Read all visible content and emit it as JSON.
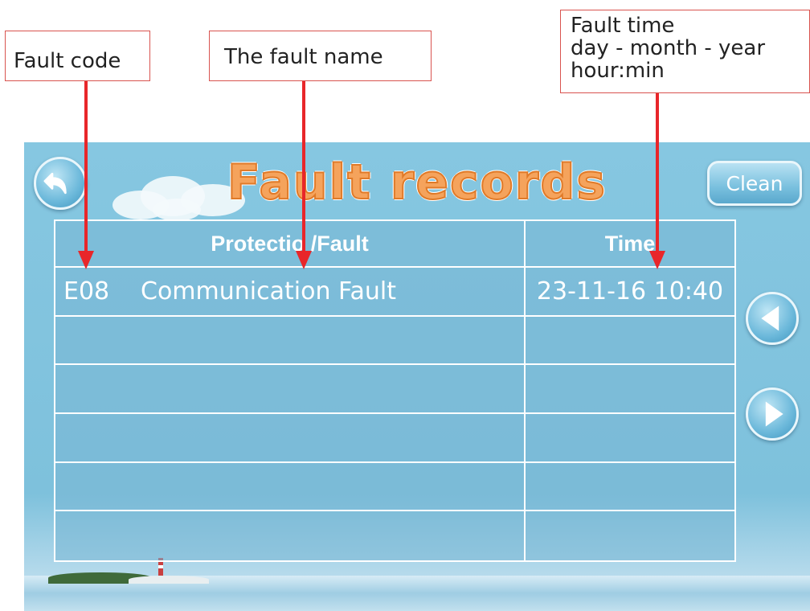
{
  "callouts": {
    "fault_code": "Fault code",
    "fault_name": "The fault name",
    "fault_time": [
      "Fault time",
      "day - month - year",
      "hour:min"
    ]
  },
  "screen": {
    "title": "Fault records",
    "clean_label": "Clean",
    "table": {
      "headers": [
        "Protectio /Fault",
        "Time"
      ],
      "rows": [
        {
          "code": "E08",
          "name": "Communication Fault",
          "time": "23-11-16 10:40"
        },
        {
          "code": "",
          "name": "",
          "time": ""
        },
        {
          "code": "",
          "name": "",
          "time": ""
        },
        {
          "code": "",
          "name": "",
          "time": ""
        },
        {
          "code": "",
          "name": "",
          "time": ""
        },
        {
          "code": "",
          "name": "",
          "time": ""
        }
      ]
    },
    "icons": {
      "back": "back-arrow-icon",
      "prev": "triangle-left-icon",
      "next": "triangle-right-icon"
    }
  },
  "colors": {
    "annotation": "#e8262a",
    "title_fill": "#f5a35c",
    "screen_bg": "#7ec1dc"
  }
}
